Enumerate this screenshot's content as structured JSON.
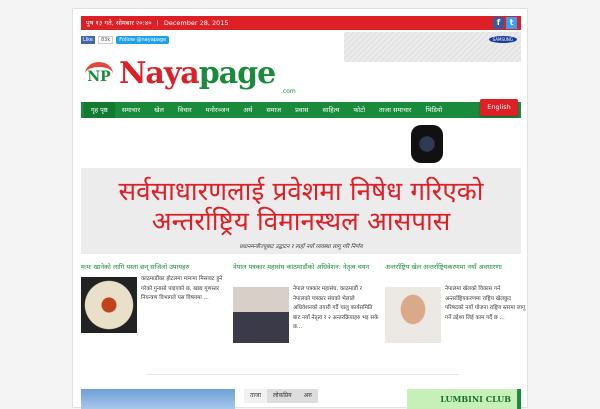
{
  "topbar": {
    "nepali_date": "पुष १३ गते, सोमबार २०:४०",
    "date": "December 28, 2015",
    "social": [
      "f",
      "t"
    ]
  },
  "social_buttons": {
    "like": "Like",
    "count": "83k",
    "follow": "Follow @nayapage"
  },
  "ad": {
    "brand": "SAMSUNG"
  },
  "logo": {
    "mark": "NP",
    "naya": "Naya",
    "page": "page",
    "com": ".com"
  },
  "nav": {
    "items": [
      "गृह पृष्ठ",
      "समाचार",
      "खेल",
      "विचार",
      "मनोरञ्जन",
      "अर्थ",
      "समाज",
      "प्रवास",
      "साहित्य",
      "फोटो",
      "ताजा समाचार",
      "भिडियो"
    ],
    "english": "English"
  },
  "hero": {
    "title": "सर्वसाधारणलाई प्रवेशमा निषेध गरिएको अन्तर्राष्ट्रिय विमानस्थल आसपास",
    "caption": "प्रधानमन्त्रीज्यूबाट उद्घाटन र त्यहाँ नयाँ व्यवस्था लागू गरि निर्णय"
  },
  "articles": [
    {
      "title": "मःमः खानेको लागि यस्ता छन् सजिलो उपायहरु",
      "excerpt": "काठमाडौंका होटलमा मःमःमा मिसावट हुने गरेको गुनासो पाइएको छ, खाद्य गुणस्तर नियन्त्रण विभागले यस विषयमा ..."
    },
    {
      "title": "नेपाल पत्रकार महासंघ काठमाडौंको अधिवेशन: नेतृत्व चयन",
      "excerpt": "नेपाल पत्रकार महासंघ, काठमाडौं र नेपालको पत्रकार संघको भेलाले अधिवेशनको तयारी गर्दै चालु कार्यसमिति बाट नयाँ नेतृत्व र २ अन्तरक्रियाहरु भइ सके छ..."
    },
    {
      "title": "अन्तर्राष्ट्रिय खेल अन्तर्राष्ट्रियकरणमा नयाँ अवधारणा",
      "excerpt": "नेपालमा खेलको विकास गर्न अन्तर्राष्ट्रियकरणमा राष्ट्रिय खेलकुद परिषदको नयाँ योजना राष्ट्रिय स्तरमा लागू गर्ने उद्देश्य लिई काम गर्दै छ ..."
    }
  ],
  "bottom_tabs": [
    "ताजा",
    "लोकप्रिय",
    "अरु"
  ],
  "sidebar_ad": {
    "text": "LUMBINI CLUB"
  }
}
